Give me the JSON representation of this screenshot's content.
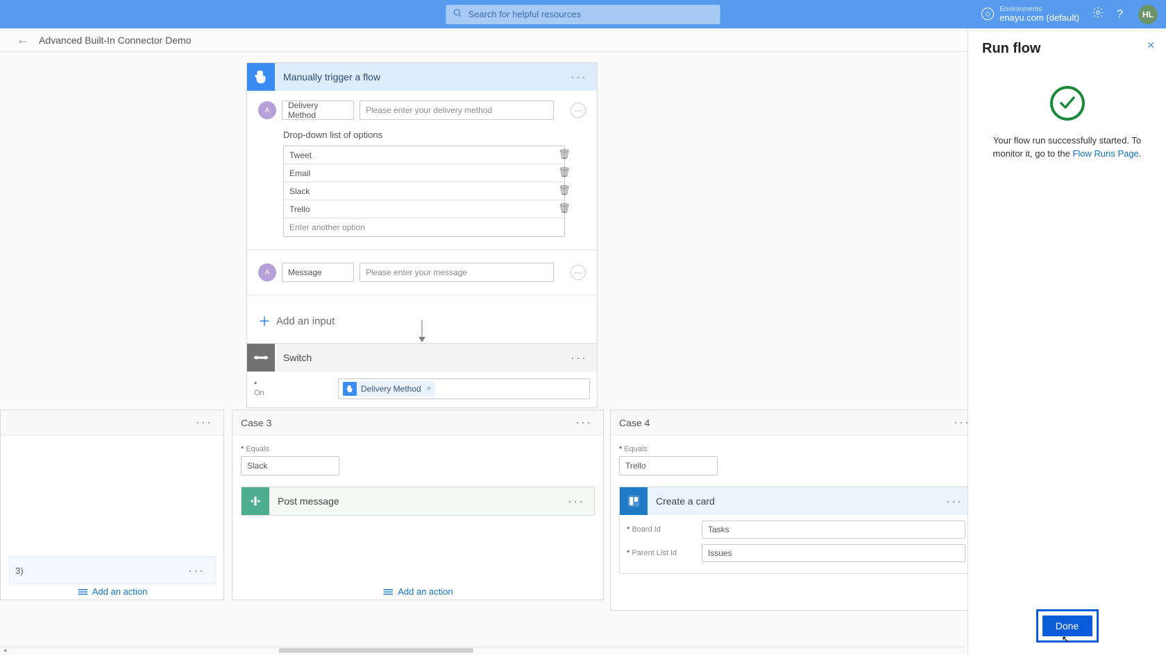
{
  "topbar": {
    "search_placeholder": "Search for helpful resources",
    "env_label": "Environments",
    "env_value": "enayu.com (default)",
    "avatar_initials": "HL"
  },
  "breadcrumb": {
    "title": "Advanced Built-In Connector Demo"
  },
  "trigger": {
    "title": "Manually trigger a flow",
    "input1_name": "Delivery Method",
    "input1_placeholder": "Please enter your delivery method",
    "dropdown_label": "Drop-down list of options",
    "options": [
      "Tweet",
      "Email",
      "Slack",
      "Trello"
    ],
    "option_blank": "Enter another option",
    "input2_name": "Message",
    "input2_placeholder": "Please enter your message",
    "add_input": "Add an input"
  },
  "switch": {
    "title": "Switch",
    "on_label": "On",
    "token_label": "Delivery Method"
  },
  "case2": {
    "tail": "3)",
    "add_action": "Add an action"
  },
  "case3": {
    "title": "Case 3",
    "equals_label": "Equals",
    "equals_value": "Slack",
    "action_title": "Post message",
    "add_action": "Add an action"
  },
  "case4": {
    "title": "Case 4",
    "equals_label": "Equals",
    "equals_value": "Trello",
    "action_title": "Create a card",
    "board_label": "Board Id",
    "board_value": "Tasks",
    "list_label": "Parent List Id",
    "list_value": "Issues"
  },
  "panel": {
    "title": "Run flow",
    "msg_pre": "Your flow run successfully started. To monitor it, go to the ",
    "link": "Flow Runs Page",
    "done": "Done"
  }
}
